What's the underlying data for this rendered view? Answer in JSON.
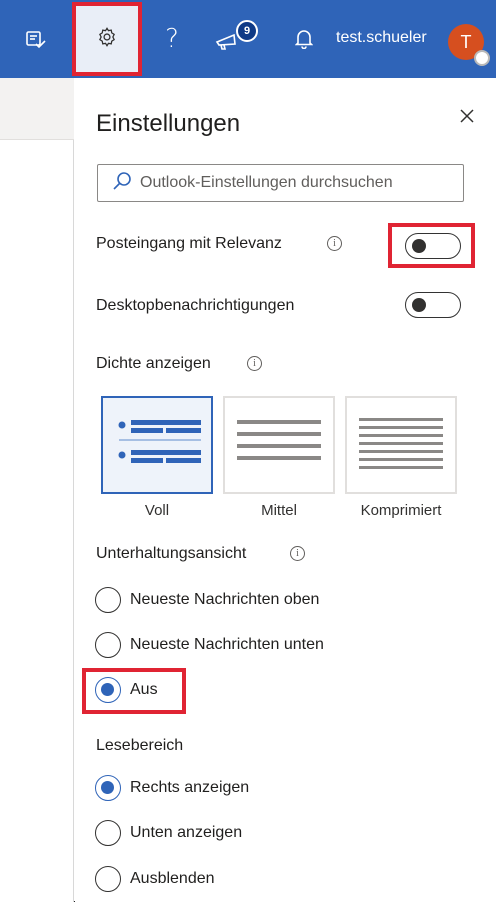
{
  "topbar": {
    "username": "test.schueler",
    "avatar_initial": "T",
    "notification_count": "9",
    "help_glyph": "?",
    "icons": [
      "todo-check-icon",
      "gear-icon",
      "help-icon",
      "megaphone-icon",
      "bell-icon"
    ],
    "bg_color": "#2f64b8",
    "avatar_color": "#d64f1f"
  },
  "settings": {
    "title": "Einstellungen",
    "search_placeholder": "Outlook-Einstellungen durchsuchen",
    "focused_inbox": {
      "label": "Posteingang mit Relevanz",
      "enabled": false
    },
    "desktop_notifications": {
      "label": "Desktopbenachrichtigungen",
      "enabled": false
    },
    "density": {
      "label": "Dichte anzeigen",
      "options": [
        "Voll",
        "Mittel",
        "Komprimiert"
      ],
      "selected": "Voll"
    },
    "conversation_view": {
      "label": "Unterhaltungsansicht",
      "options": [
        "Neueste Nachrichten oben",
        "Neueste Nachrichten unten",
        "Aus"
      ],
      "selected": "Aus"
    },
    "reading_pane": {
      "label": "Lesebereich",
      "options": [
        "Rechts anzeigen",
        "Unten anzeigen",
        "Ausblenden"
      ],
      "selected": "Rechts anzeigen"
    }
  },
  "highlight_color": "#e02433",
  "accent_color": "#2f64b8"
}
